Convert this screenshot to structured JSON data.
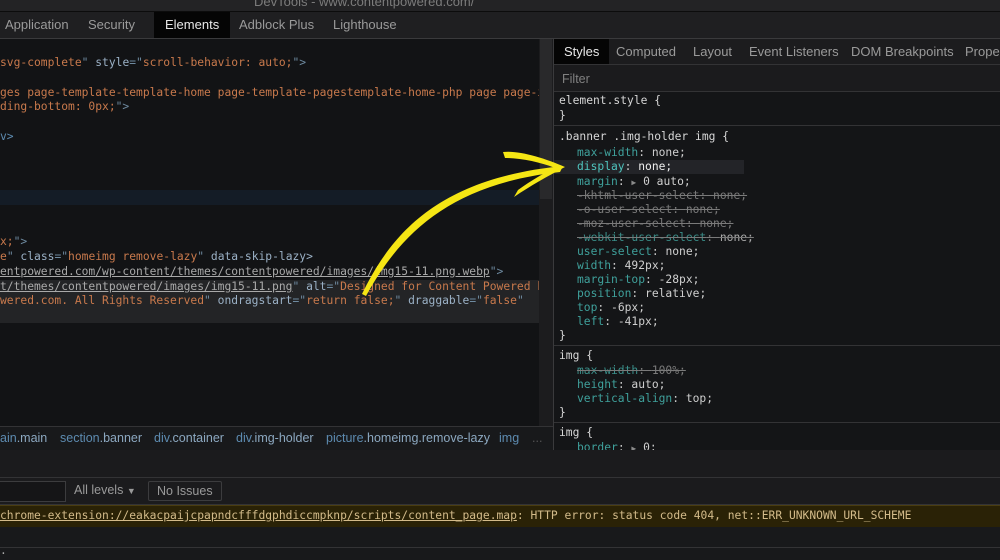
{
  "window": {
    "title": "DevTools - www.contentpowered.com/"
  },
  "main_tabs": [
    {
      "label": "Application",
      "active": false
    },
    {
      "label": "Security",
      "active": false
    },
    {
      "label": "Elements",
      "active": true
    },
    {
      "label": "Adblock Plus",
      "active": false
    },
    {
      "label": "Lighthouse",
      "active": false
    }
  ],
  "elements_tree": {
    "line1": {
      "a": "svg-complete",
      "q1": "\" ",
      "attr": "style",
      "eq": "=\"",
      "val": "scroll-behavior: auto;",
      "end": "\">"
    },
    "line2": {
      "text": "ges page-template-template-home page-template-pagestemplate-home-php page page-id"
    },
    "line3": {
      "val": "ding-bottom: 0px;",
      "end": "\">"
    },
    "line4": {
      "tag": "v>"
    },
    "line5": {
      "val": "x;",
      "end": "\">"
    },
    "line6": {
      "v": "e",
      "attr": "class",
      "val": "homeimg remove-lazy",
      "attr2": "data-skip-lazy>"
    },
    "line7": {
      "link": "entpowered.com/wp-content/themes/contentpowered/images/img15-11.png.webp",
      "end": "\">"
    },
    "line8": {
      "link": "t/themes/contentpowered/images/img15-11.png",
      "attr": "alt",
      "val": "Designed for Content Powered by"
    },
    "line9": {
      "val": "wered.com. All Rights Reserved",
      "attr": "ondragstart",
      "val2": "return false;",
      "attr2": "draggable",
      "val3": "false"
    }
  },
  "breadcrumb": [
    {
      "tag": "ain",
      "cls": ".main"
    },
    {
      "tag": "section",
      "cls": ".banner"
    },
    {
      "tag": "div",
      "cls": ".container"
    },
    {
      "tag": "div",
      "cls": ".img-holder"
    },
    {
      "tag": "picture",
      "cls": ".homeimg.remove-lazy"
    },
    {
      "tag": "img",
      "cls": ""
    },
    {
      "tag": "...",
      "cls": ""
    }
  ],
  "styles_tabs": [
    {
      "label": "Styles",
      "active": true
    },
    {
      "label": "Computed",
      "active": false
    },
    {
      "label": "Layout",
      "active": false
    },
    {
      "label": "Event Listeners",
      "active": false
    },
    {
      "label": "DOM Breakpoints",
      "active": false
    },
    {
      "label": "Proper",
      "active": false
    }
  ],
  "filter": {
    "placeholder": "Filter",
    "value": ""
  },
  "rules": [
    {
      "selector": "element.style {",
      "close": "}",
      "props": []
    },
    {
      "selector": ".banner .img-holder img {",
      "close": "}",
      "props": [
        {
          "name": "max-width",
          "value": "none;",
          "strike": false
        },
        {
          "name": "display",
          "value": "none;",
          "strike": false,
          "highlight": true
        },
        {
          "name": "margin",
          "value": "0 auto;",
          "strike": false,
          "expand": true
        },
        {
          "name": "-khtml-user-select",
          "value": "none;",
          "strike": true
        },
        {
          "name": "-o-user-select",
          "value": "none;",
          "strike": true
        },
        {
          "name": "-moz-user-select",
          "value": "none;",
          "strike": true
        },
        {
          "name": "-webkit-user-select",
          "value": "none;",
          "strike": true
        },
        {
          "name": "user-select",
          "value": "none;",
          "strike": false
        },
        {
          "name": "width",
          "value": "492px;",
          "strike": false
        },
        {
          "name": "margin-top",
          "value": "-28px;",
          "strike": false
        },
        {
          "name": "position",
          "value": "relative;",
          "strike": false
        },
        {
          "name": "top",
          "value": "-6px;",
          "strike": false
        },
        {
          "name": "left",
          "value": "-41px;",
          "strike": false
        }
      ]
    },
    {
      "selector": "img {",
      "close": "}",
      "props": [
        {
          "name": "max-width",
          "value": "100%;",
          "strike": true
        },
        {
          "name": "height",
          "value": "auto;",
          "strike": false
        },
        {
          "name": "vertical-align",
          "value": "top;",
          "strike": false
        }
      ]
    },
    {
      "selector": "img {",
      "props": [
        {
          "name": "border",
          "value": "0;",
          "strike": false,
          "expand": true
        }
      ]
    }
  ],
  "console": {
    "levels_label": "All levels",
    "levels_arrow": "▼",
    "issues_label": "No Issues",
    "warning": {
      "link": "chrome-extension://eakacpaijcpapndcfffdgphdiccmpknp/scripts/content_page.map",
      "text": ": HTTP error: status code 404, net::ERR_UNKNOWN_URL_SCHEME"
    },
    "prompt": "."
  },
  "annotation": {
    "type": "arrow",
    "color": "#f5e614",
    "points_to": "display: none;"
  }
}
